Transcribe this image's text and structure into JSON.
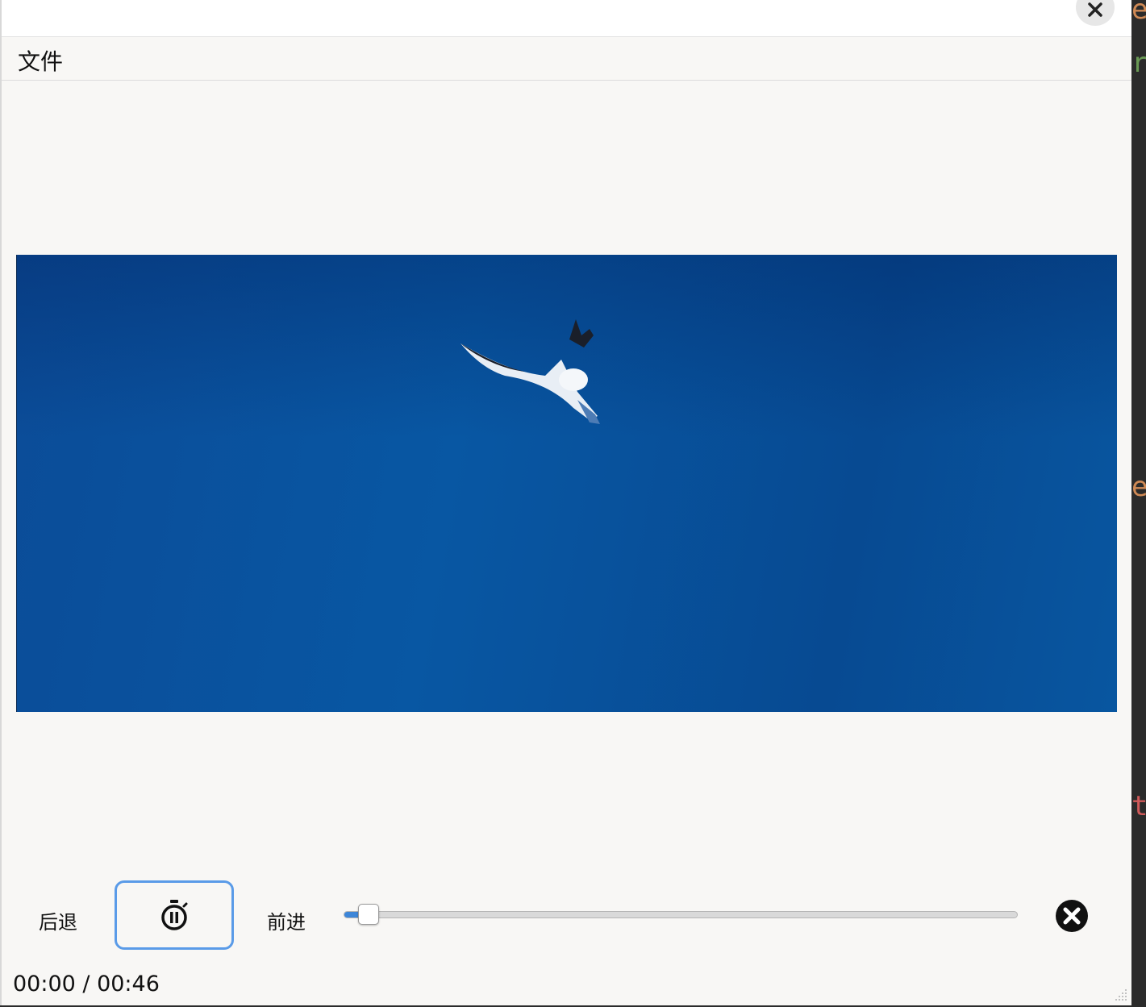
{
  "menu": {
    "file_label": "文件"
  },
  "controls": {
    "back_label": "后退",
    "forward_label": "前进",
    "progress_fraction": 0.036
  },
  "time": {
    "current": "00:00",
    "total": "00:46",
    "display": "00:00 / 00:46"
  },
  "editor_glyphs": [
    {
      "char": "e",
      "color": "#d08a55"
    },
    {
      "char": "r",
      "color": "#6a9a55"
    },
    {
      "char": "e",
      "color": "#d08a55"
    },
    {
      "char": "t",
      "color": "#d05a5a"
    }
  ],
  "icons": {
    "close": "close-icon",
    "pause": "pause-timer-icon",
    "stop": "stop-circle-icon",
    "grip": "resize-grip-icon"
  },
  "colors": {
    "accent": "#5a9be8",
    "slider_fill": "#3d86d8",
    "video_sky": "#0857a3"
  }
}
